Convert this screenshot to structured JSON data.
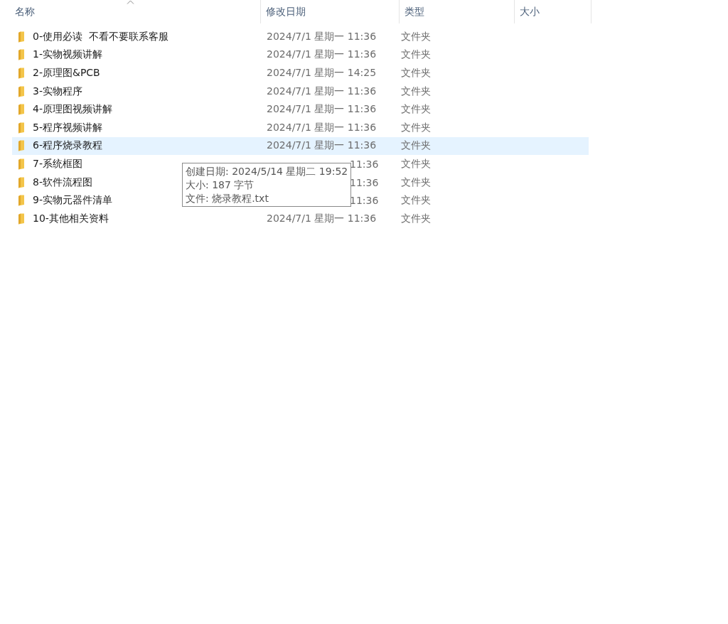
{
  "columns": [
    {
      "label": "名称",
      "sorted": true
    },
    {
      "label": "修改日期",
      "sorted": false
    },
    {
      "label": "类型",
      "sorted": false
    },
    {
      "label": "大小",
      "sorted": false
    }
  ],
  "rows": [
    {
      "name": "0-使用必读  不看不要联系客服",
      "date": "2024/7/1 星期一 11:36",
      "type": "文件夹",
      "selected": false,
      "date_partial": false
    },
    {
      "name": "1-实物视频讲解",
      "date": "2024/7/1 星期一 11:36",
      "type": "文件夹",
      "selected": false,
      "date_partial": false
    },
    {
      "name": "2-原理图&PCB",
      "date": "2024/7/1 星期一 14:25",
      "type": "文件夹",
      "selected": false,
      "date_partial": false
    },
    {
      "name": "3-实物程序",
      "date": "2024/7/1 星期一 11:36",
      "type": "文件夹",
      "selected": false,
      "date_partial": false
    },
    {
      "name": "4-原理图视频讲解",
      "date": "2024/7/1 星期一 11:36",
      "type": "文件夹",
      "selected": false,
      "date_partial": false
    },
    {
      "name": "5-程序视频讲解",
      "date": "2024/7/1 星期一 11:36",
      "type": "文件夹",
      "selected": false,
      "date_partial": false
    },
    {
      "name": "6-程序烧录教程",
      "date": "2024/7/1 星期一 11:36",
      "type": "文件夹",
      "selected": true,
      "date_partial": false
    },
    {
      "name": "7-系统框图",
      "date": "11:36",
      "type": "文件夹",
      "selected": false,
      "date_partial": true
    },
    {
      "name": "8-软件流程图",
      "date": "11:36",
      "type": "文件夹",
      "selected": false,
      "date_partial": true
    },
    {
      "name": "9-实物元器件清单",
      "date": "11:36",
      "type": "文件夹",
      "selected": false,
      "date_partial": true
    },
    {
      "name": "10-其他相关资料",
      "date": "2024/7/1 星期一 11:36",
      "type": "文件夹",
      "selected": false,
      "date_partial": false
    }
  ],
  "tooltip": {
    "lines": [
      "创建日期: 2024/5/14 星期二 19:52",
      "大小: 187 字节",
      "文件: 烧录教程.txt"
    ]
  }
}
